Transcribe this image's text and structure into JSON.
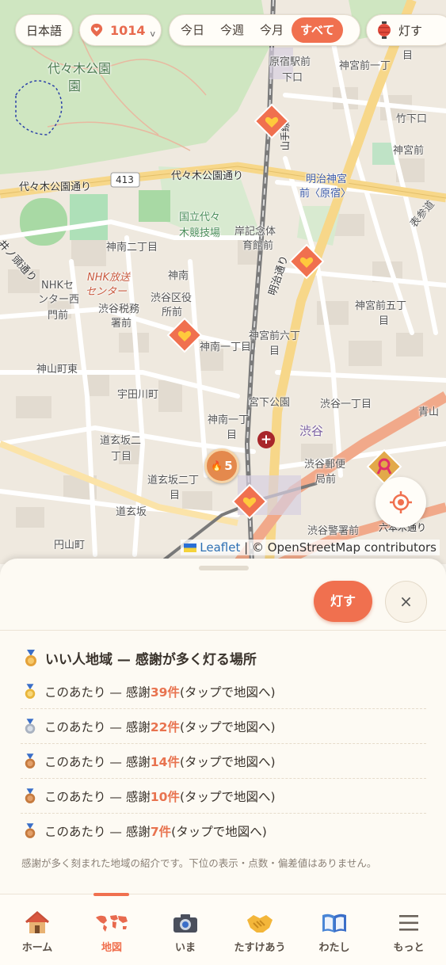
{
  "map": {
    "language": "日本語",
    "count": "1014",
    "range_tabs": [
      "今日",
      "今週",
      "今月",
      "すべて"
    ],
    "active_range": "すべて",
    "light_filter": "灯す",
    "labels": {
      "yoyogi_park": "代々木公園",
      "park_mark": "園",
      "harajuku_sta": "原宿駅前",
      "harajuku_sta2": "下口",
      "jingumae1": "神宮前一丁",
      "jingumae1b": "目",
      "takeshita": "竹下口",
      "jingumae_top": "神宮前",
      "meiji_jingumae": "明治神宮",
      "meiji_jingumae2": "前〈原宿〉",
      "yoyogi_dori": "代々木公園通り",
      "yoyogi_dori2": "代々木公園通り",
      "route413": "413",
      "kokuritsu": "国立代々",
      "kokuritsu2": "木競技場",
      "kishi": "岸記念体",
      "kishi2": "育館前",
      "jinnan2": "神南二丁目",
      "jinnan": "神南",
      "nhk_center": "NHK放送",
      "nhk_center2": "センター",
      "nhk_west": "NHKセ",
      "nhk_west2": "ンター西",
      "nhk_west3": "門前",
      "shibuya_tax": "渋谷税務",
      "shibuya_tax2": "署前",
      "shibuya_ward": "渋谷区役",
      "shibuya_ward2": "所前",
      "jinnan1": "神南一丁目",
      "jingumae6": "神宮前六丁",
      "jingumae6b": "目",
      "jingumae5": "神宮前五丁",
      "jingumae5b": "目",
      "meiji_dori": "明治通り",
      "omotesando": "表参道",
      "kamiyama": "神山町東",
      "udagawa": "宇田川町",
      "miyashita": "宮下公園",
      "shibuya1": "渋谷一丁目",
      "jinnan1b": "神南一丁",
      "jinnan1c": "目",
      "shibuya": "渋谷",
      "dogenzaka2": "道玄坂二",
      "dogenzaka2b": "丁目",
      "dogenzaka2c": "道玄坂二丁",
      "dogenzaka2d": "目",
      "dogenzaka": "道玄坂",
      "post": "渋谷郵便",
      "post2": "局前",
      "aoyama": "青山",
      "police": "渋谷警署前",
      "maruyama": "円山町",
      "ino": "井ノ頭通り",
      "yamanote": "山手線",
      "route246": "六本木通り"
    },
    "burst_count": "5",
    "attribution_leaflet": "Leaflet",
    "attribution_rest": "| © OpenStreetMap contributors"
  },
  "sheet": {
    "light_button": "灯す",
    "close_button": "×",
    "title": "いい人地域 — 感謝が多く灯る場所",
    "rows": [
      {
        "prefix": "このあたり — 感謝 ",
        "count": "39件",
        "suffix": "(タップで地図へ)",
        "medal": "gold"
      },
      {
        "prefix": "このあたり — 感謝 ",
        "count": "22件",
        "suffix": "(タップで地図へ)",
        "medal": "silver"
      },
      {
        "prefix": "このあたり — 感謝 ",
        "count": "14件",
        "suffix": "(タップで地図へ)",
        "medal": "bronze"
      },
      {
        "prefix": "このあたり — 感謝 ",
        "count": "10件",
        "suffix": "(タップで地図へ)",
        "medal": "bronze"
      },
      {
        "prefix": "このあたり — 感謝 ",
        "count": "7件",
        "suffix": "(タップで地図へ)",
        "medal": "bronze"
      }
    ],
    "note": "感謝が多く刻まれた地域の紹介です。下位の表示・点数・偏差値はありません。"
  },
  "nav": {
    "items": [
      {
        "label": "ホーム",
        "icon": "house-icon"
      },
      {
        "label": "地図",
        "icon": "world-map-icon"
      },
      {
        "label": "いま",
        "icon": "camera-icon"
      },
      {
        "label": "たすけあう",
        "icon": "handshake-icon"
      },
      {
        "label": "わたし",
        "icon": "book-icon"
      },
      {
        "label": "もっと",
        "icon": "menu-icon"
      }
    ],
    "active": "地図"
  },
  "colors": {
    "accent": "#f0704f",
    "park": "#cfe6c1",
    "rail": "#888888",
    "major_road": "#f7d789",
    "heart_marker": "#f0704f"
  }
}
